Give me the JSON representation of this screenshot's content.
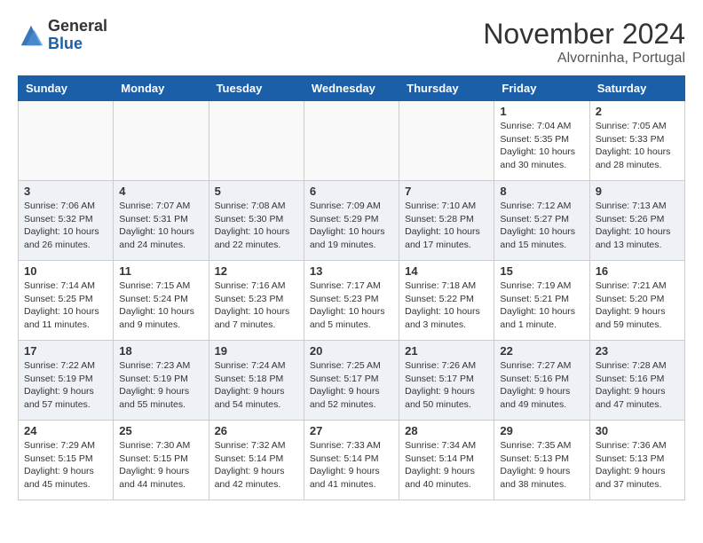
{
  "header": {
    "logo_line1": "General",
    "logo_line2": "Blue",
    "month": "November 2024",
    "location": "Alvorninha, Portugal"
  },
  "days_of_week": [
    "Sunday",
    "Monday",
    "Tuesday",
    "Wednesday",
    "Thursday",
    "Friday",
    "Saturday"
  ],
  "weeks": [
    {
      "row_class": "week-row-1",
      "days": [
        {
          "num": "",
          "empty": true
        },
        {
          "num": "",
          "empty": true
        },
        {
          "num": "",
          "empty": true
        },
        {
          "num": "",
          "empty": true
        },
        {
          "num": "",
          "empty": true
        },
        {
          "num": "1",
          "sunrise": "Sunrise: 7:04 AM",
          "sunset": "Sunset: 5:35 PM",
          "daylight": "Daylight: 10 hours and 30 minutes."
        },
        {
          "num": "2",
          "sunrise": "Sunrise: 7:05 AM",
          "sunset": "Sunset: 5:33 PM",
          "daylight": "Daylight: 10 hours and 28 minutes."
        }
      ]
    },
    {
      "row_class": "week-row-2",
      "days": [
        {
          "num": "3",
          "sunrise": "Sunrise: 7:06 AM",
          "sunset": "Sunset: 5:32 PM",
          "daylight": "Daylight: 10 hours and 26 minutes."
        },
        {
          "num": "4",
          "sunrise": "Sunrise: 7:07 AM",
          "sunset": "Sunset: 5:31 PM",
          "daylight": "Daylight: 10 hours and 24 minutes."
        },
        {
          "num": "5",
          "sunrise": "Sunrise: 7:08 AM",
          "sunset": "Sunset: 5:30 PM",
          "daylight": "Daylight: 10 hours and 22 minutes."
        },
        {
          "num": "6",
          "sunrise": "Sunrise: 7:09 AM",
          "sunset": "Sunset: 5:29 PM",
          "daylight": "Daylight: 10 hours and 19 minutes."
        },
        {
          "num": "7",
          "sunrise": "Sunrise: 7:10 AM",
          "sunset": "Sunset: 5:28 PM",
          "daylight": "Daylight: 10 hours and 17 minutes."
        },
        {
          "num": "8",
          "sunrise": "Sunrise: 7:12 AM",
          "sunset": "Sunset: 5:27 PM",
          "daylight": "Daylight: 10 hours and 15 minutes."
        },
        {
          "num": "9",
          "sunrise": "Sunrise: 7:13 AM",
          "sunset": "Sunset: 5:26 PM",
          "daylight": "Daylight: 10 hours and 13 minutes."
        }
      ]
    },
    {
      "row_class": "week-row-3",
      "days": [
        {
          "num": "10",
          "sunrise": "Sunrise: 7:14 AM",
          "sunset": "Sunset: 5:25 PM",
          "daylight": "Daylight: 10 hours and 11 minutes."
        },
        {
          "num": "11",
          "sunrise": "Sunrise: 7:15 AM",
          "sunset": "Sunset: 5:24 PM",
          "daylight": "Daylight: 10 hours and 9 minutes."
        },
        {
          "num": "12",
          "sunrise": "Sunrise: 7:16 AM",
          "sunset": "Sunset: 5:23 PM",
          "daylight": "Daylight: 10 hours and 7 minutes."
        },
        {
          "num": "13",
          "sunrise": "Sunrise: 7:17 AM",
          "sunset": "Sunset: 5:23 PM",
          "daylight": "Daylight: 10 hours and 5 minutes."
        },
        {
          "num": "14",
          "sunrise": "Sunrise: 7:18 AM",
          "sunset": "Sunset: 5:22 PM",
          "daylight": "Daylight: 10 hours and 3 minutes."
        },
        {
          "num": "15",
          "sunrise": "Sunrise: 7:19 AM",
          "sunset": "Sunset: 5:21 PM",
          "daylight": "Daylight: 10 hours and 1 minute."
        },
        {
          "num": "16",
          "sunrise": "Sunrise: 7:21 AM",
          "sunset": "Sunset: 5:20 PM",
          "daylight": "Daylight: 9 hours and 59 minutes."
        }
      ]
    },
    {
      "row_class": "week-row-4",
      "days": [
        {
          "num": "17",
          "sunrise": "Sunrise: 7:22 AM",
          "sunset": "Sunset: 5:19 PM",
          "daylight": "Daylight: 9 hours and 57 minutes."
        },
        {
          "num": "18",
          "sunrise": "Sunrise: 7:23 AM",
          "sunset": "Sunset: 5:19 PM",
          "daylight": "Daylight: 9 hours and 55 minutes."
        },
        {
          "num": "19",
          "sunrise": "Sunrise: 7:24 AM",
          "sunset": "Sunset: 5:18 PM",
          "daylight": "Daylight: 9 hours and 54 minutes."
        },
        {
          "num": "20",
          "sunrise": "Sunrise: 7:25 AM",
          "sunset": "Sunset: 5:17 PM",
          "daylight": "Daylight: 9 hours and 52 minutes."
        },
        {
          "num": "21",
          "sunrise": "Sunrise: 7:26 AM",
          "sunset": "Sunset: 5:17 PM",
          "daylight": "Daylight: 9 hours and 50 minutes."
        },
        {
          "num": "22",
          "sunrise": "Sunrise: 7:27 AM",
          "sunset": "Sunset: 5:16 PM",
          "daylight": "Daylight: 9 hours and 49 minutes."
        },
        {
          "num": "23",
          "sunrise": "Sunrise: 7:28 AM",
          "sunset": "Sunset: 5:16 PM",
          "daylight": "Daylight: 9 hours and 47 minutes."
        }
      ]
    },
    {
      "row_class": "week-row-5",
      "days": [
        {
          "num": "24",
          "sunrise": "Sunrise: 7:29 AM",
          "sunset": "Sunset: 5:15 PM",
          "daylight": "Daylight: 9 hours and 45 minutes."
        },
        {
          "num": "25",
          "sunrise": "Sunrise: 7:30 AM",
          "sunset": "Sunset: 5:15 PM",
          "daylight": "Daylight: 9 hours and 44 minutes."
        },
        {
          "num": "26",
          "sunrise": "Sunrise: 7:32 AM",
          "sunset": "Sunset: 5:14 PM",
          "daylight": "Daylight: 9 hours and 42 minutes."
        },
        {
          "num": "27",
          "sunrise": "Sunrise: 7:33 AM",
          "sunset": "Sunset: 5:14 PM",
          "daylight": "Daylight: 9 hours and 41 minutes."
        },
        {
          "num": "28",
          "sunrise": "Sunrise: 7:34 AM",
          "sunset": "Sunset: 5:14 PM",
          "daylight": "Daylight: 9 hours and 40 minutes."
        },
        {
          "num": "29",
          "sunrise": "Sunrise: 7:35 AM",
          "sunset": "Sunset: 5:13 PM",
          "daylight": "Daylight: 9 hours and 38 minutes."
        },
        {
          "num": "30",
          "sunrise": "Sunrise: 7:36 AM",
          "sunset": "Sunset: 5:13 PM",
          "daylight": "Daylight: 9 hours and 37 minutes."
        }
      ]
    }
  ]
}
